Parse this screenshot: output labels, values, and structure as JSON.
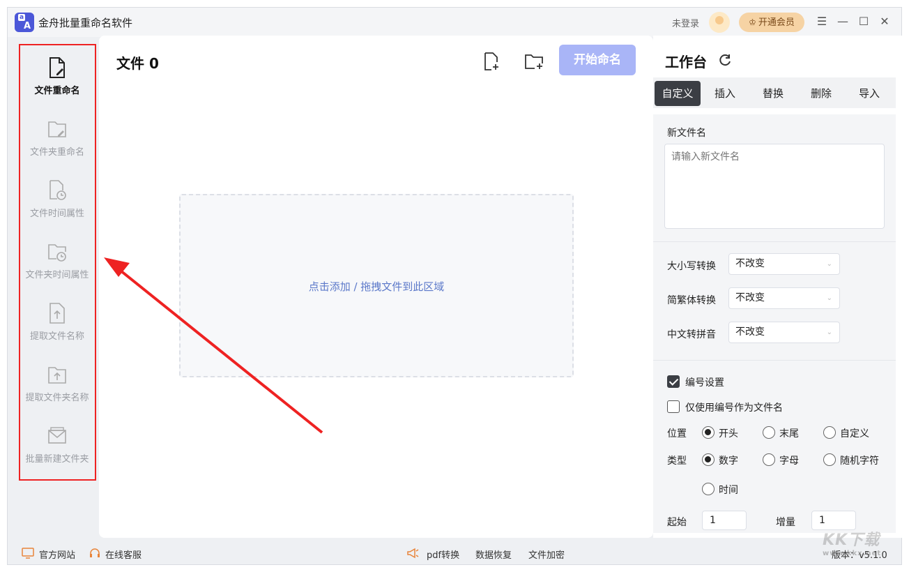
{
  "app": {
    "title": "金舟批量重命名软件",
    "login_status": "未登录",
    "vip_button": "开通会员"
  },
  "sidebar": {
    "items": [
      {
        "label": "文件重命名",
        "icon": "file-edit-icon",
        "active": true
      },
      {
        "label": "文件夹重命名",
        "icon": "folder-edit-icon",
        "active": false
      },
      {
        "label": "文件时间属性",
        "icon": "file-clock-icon",
        "active": false
      },
      {
        "label": "文件夹时间属性",
        "icon": "folder-clock-icon",
        "active": false
      },
      {
        "label": "提取文件名称",
        "icon": "file-upload-icon",
        "active": false
      },
      {
        "label": "提取文件夹名称",
        "icon": "folder-upload-icon",
        "active": false
      },
      {
        "label": "批量新建文件夹",
        "icon": "folder-new-icon",
        "active": false
      }
    ]
  },
  "main": {
    "file_count_label": "文件 0",
    "start_button": "开始命名",
    "drop_zone_text": "点击添加 / 拖拽文件到此区域"
  },
  "workbench": {
    "title": "工作台",
    "tabs": [
      {
        "label": "自定义",
        "active": true
      },
      {
        "label": "插入",
        "active": false
      },
      {
        "label": "替换",
        "active": false
      },
      {
        "label": "删除",
        "active": false
      },
      {
        "label": "导入",
        "active": false
      }
    ],
    "new_name_label": "新文件名",
    "new_name_placeholder": "请输入新文件名",
    "case_convert": {
      "label": "大小写转换",
      "value": "不改变"
    },
    "simp_trad_convert": {
      "label": "简繁体转换",
      "value": "不改变"
    },
    "pinyin_convert": {
      "label": "中文转拼音",
      "value": "不改变"
    },
    "numbering": {
      "label": "编号设置",
      "checked": true
    },
    "number_only": {
      "label": "仅使用编号作为文件名",
      "checked": false
    },
    "position": {
      "label": "位置",
      "options": [
        {
          "label": "开头",
          "checked": true
        },
        {
          "label": "末尾",
          "checked": false
        },
        {
          "label": "自定义",
          "checked": false
        }
      ]
    },
    "type": {
      "label": "类型",
      "options": [
        {
          "label": "数字",
          "checked": true
        },
        {
          "label": "字母",
          "checked": false
        },
        {
          "label": "随机字符",
          "checked": false
        },
        {
          "label": "时间",
          "checked": false
        }
      ]
    },
    "start": {
      "label": "起始",
      "value": "1"
    },
    "step": {
      "label": "增量",
      "value": "1"
    }
  },
  "statusbar": {
    "website": "官方网站",
    "support": "在线客服",
    "pdf": "pdf转换",
    "recovery": "数据恢复",
    "encrypt": "文件加密",
    "version": "版本：v5.1.0"
  },
  "watermark": {
    "text": "KK下载",
    "url": "www.kkx.net"
  },
  "colors": {
    "annotation_red": "#ee2222",
    "start_button": "#a9b5f7",
    "active_tab": "#3b3e44",
    "link_blue": "#5b78c9"
  }
}
